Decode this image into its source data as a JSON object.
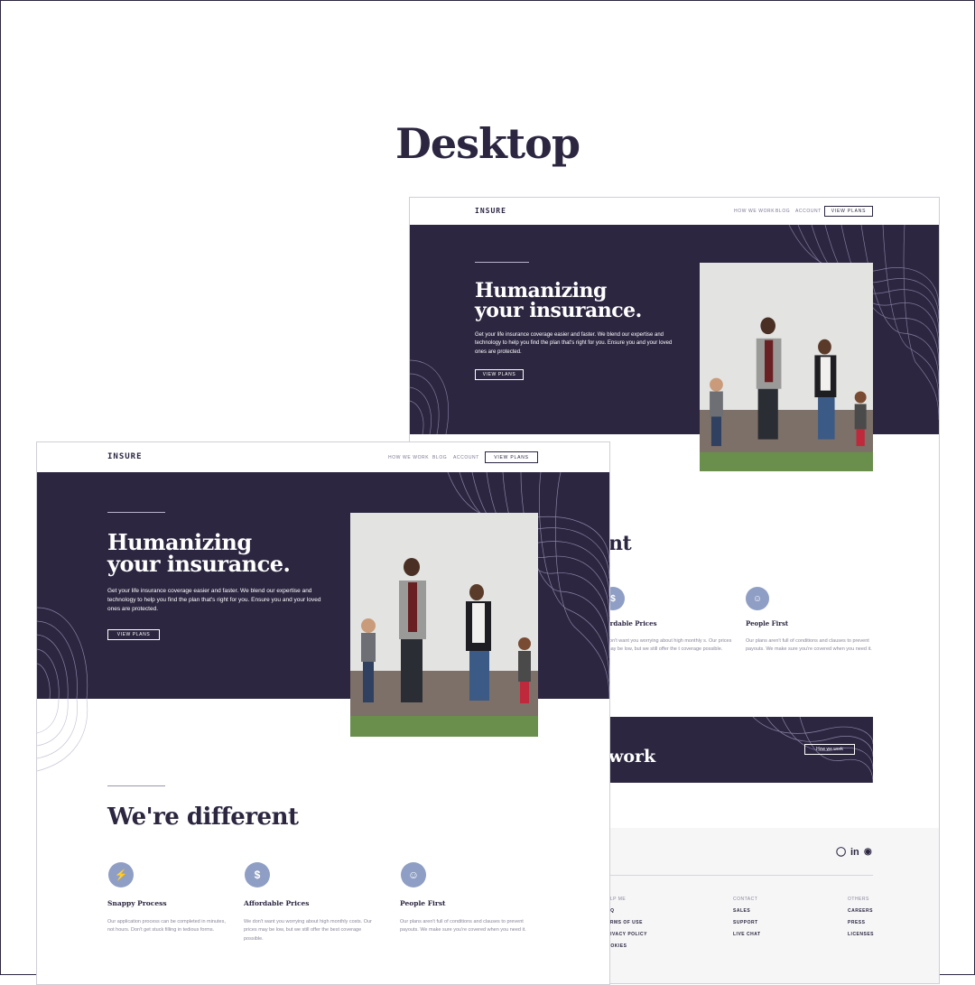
{
  "page": {
    "heading": "Desktop"
  },
  "site": {
    "logo": "INSURE",
    "nav": {
      "how_we_work": "HOW WE WORK",
      "blog": "BLOG",
      "account": "ACCOUNT",
      "view_plans": "VIEW PLANS"
    },
    "hero": {
      "title_line1": "Humanizing",
      "title_line2": "your insurance.",
      "text": "Get your life insurance coverage easier and faster. We blend our expertise and technology to help you find the plan that's right for you. Ensure you and your loved ones are protected.",
      "button": "VIEW PLANS"
    },
    "different": {
      "title": "We're different",
      "partial_title": "nt",
      "features": [
        {
          "icon": "lightning-icon",
          "title": "Snappy Process",
          "text": "Our application process can be completed in minutes, not hours. Don't get stuck filling in tedious forms."
        },
        {
          "icon": "dollar-icon",
          "title": "Affordable Prices",
          "text": "We don't want you worrying about high monthly costs. Our prices may be low, but we still offer the best coverage possible."
        },
        {
          "icon": "person-icon",
          "title": "People First",
          "text": "Our plans aren't full of conditions and clauses to prevent payouts. We make sure you're covered when you need it."
        }
      ],
      "partial_feature_title": "fordable Prices",
      "partial_feature_text": "don't want you worrying about high monthly s. Our prices may be low, but we still offer the t coverage possible."
    },
    "cta": {
      "partial_title": "work",
      "button": "How we work"
    },
    "footer": {
      "social": [
        "instagram-icon",
        "linkedin-icon",
        "github-icon"
      ],
      "col1_title": "ELP ME",
      "col1_links": [
        "AQ",
        "ERMS OF USE",
        "RIVACY POLICY",
        "OOKIES"
      ],
      "col2_title": "CONTACT",
      "col2_links": [
        "SALES",
        "SUPPORT",
        "LIVE CHAT"
      ],
      "col3_title": "OTHERS",
      "col3_links": [
        "CAREERS",
        "PRESS",
        "LICENSES"
      ]
    }
  },
  "colors": {
    "primary": "#2c2640",
    "accent": "#8f9ec4",
    "footer_bg": "#f6f6f7"
  }
}
